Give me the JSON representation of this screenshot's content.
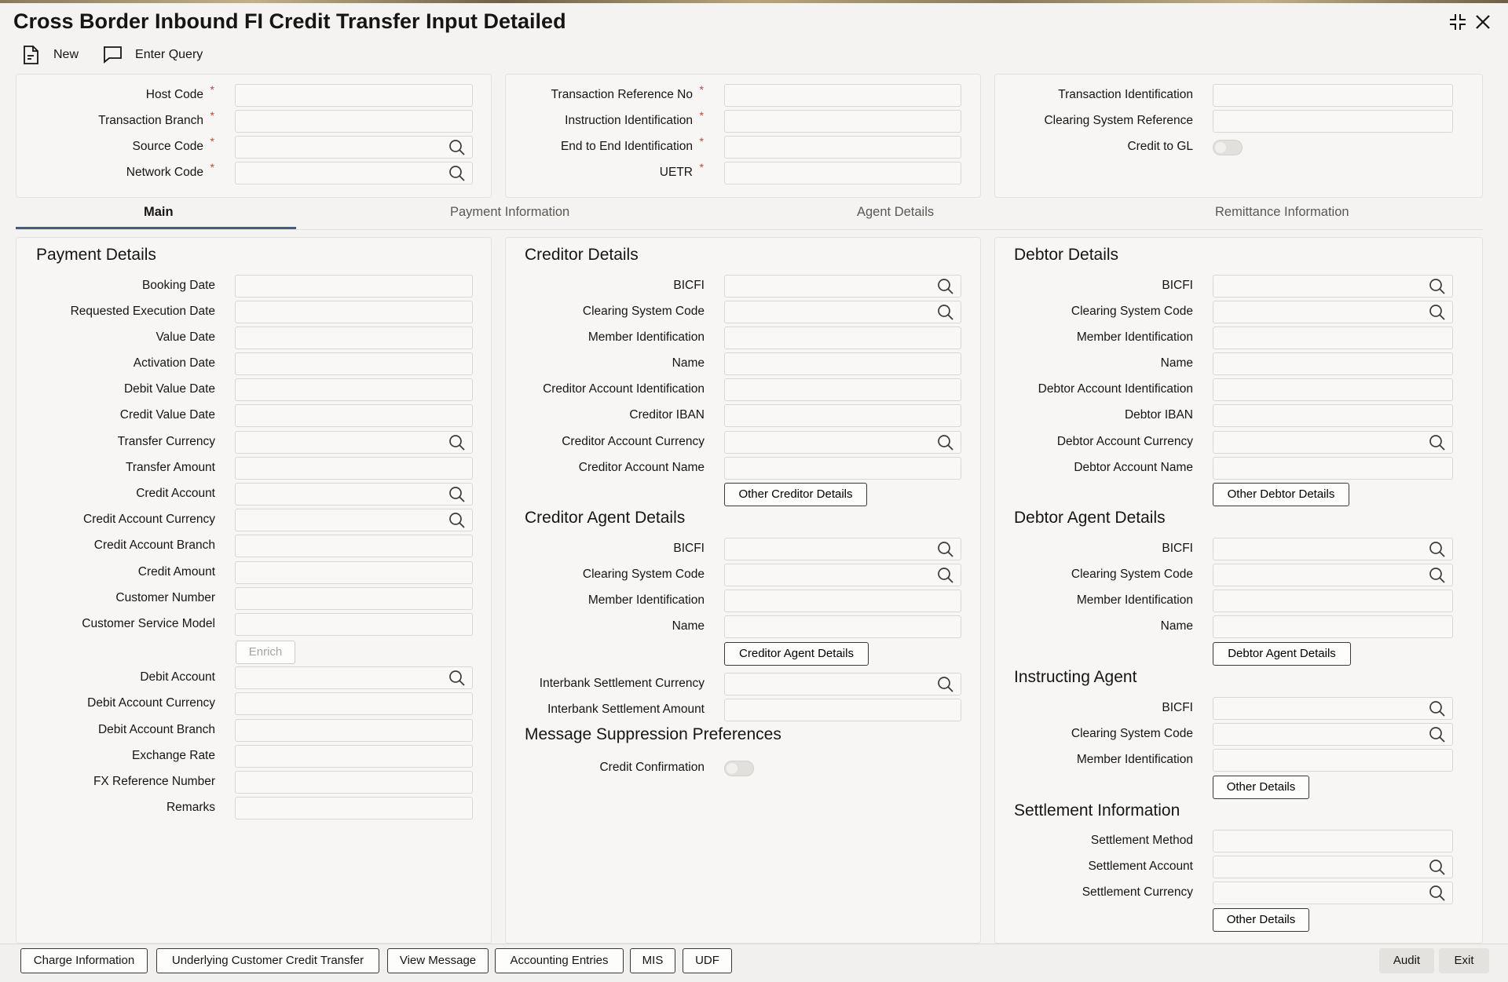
{
  "window": {
    "title": "Cross Border Inbound FI Credit Transfer Input Detailed"
  },
  "toolbar": {
    "new_label": "New",
    "enter_query_label": "Enter Query"
  },
  "header": {
    "col1": [
      {
        "label": "Host Code",
        "required": "*"
      },
      {
        "label": "Transaction Branch",
        "required": "*"
      },
      {
        "label": "Source Code",
        "required": "*"
      },
      {
        "label": "Network Code",
        "required": "*"
      }
    ],
    "col2": [
      {
        "label": "Transaction Reference No",
        "required": "*"
      },
      {
        "label": "Instruction Identification",
        "required": "*"
      },
      {
        "label": "End to End Identification",
        "required": "*"
      },
      {
        "label": "UETR",
        "required": "*"
      }
    ],
    "col3": [
      {
        "label": "Transaction Identification"
      },
      {
        "label": "Clearing System Reference"
      },
      {
        "label": "Credit to GL"
      }
    ]
  },
  "tabs": [
    "Main",
    "Payment Information",
    "Agent Details",
    "Remittance Information"
  ],
  "payment_details": {
    "title": "Payment Details",
    "fields": [
      "Booking Date",
      "Requested Execution Date",
      "Value Date",
      "Activation Date",
      "Debit Value Date",
      "Credit Value Date",
      "Transfer Currency",
      "Transfer Amount",
      "Credit Account",
      "Credit Account Currency",
      "Credit Account Branch",
      "Credit Amount",
      "Customer Number",
      "Customer Service Model"
    ],
    "enrich_label": "Enrich",
    "fields2": [
      "Debit Account",
      "Debit Account Currency",
      "Debit Account Branch",
      "Exchange Rate",
      "FX Reference Number",
      "Remarks"
    ]
  },
  "creditor_details": {
    "title": "Creditor Details",
    "fields": [
      "BICFI",
      "Clearing System Code",
      "Member Identification",
      "Name",
      "Creditor Account Identification",
      "Creditor IBAN",
      "Creditor Account Currency",
      "Creditor Account Name"
    ],
    "button": "Other Creditor Details"
  },
  "creditor_agent": {
    "title": "Creditor Agent Details",
    "fields": [
      "BICFI",
      "Clearing System Code",
      "Member Identification",
      "Name"
    ],
    "button": "Creditor Agent Details",
    "fields2": [
      "Interbank Settlement Currency",
      "Interbank Settlement Amount"
    ]
  },
  "message_suppression": {
    "title": "Message Suppression Preferences",
    "credit_confirmation": "Credit Confirmation"
  },
  "debtor_details": {
    "title": "Debtor Details",
    "fields": [
      "BICFI",
      "Clearing System Code",
      "Member Identification",
      "Name",
      "Debtor Account Identification",
      "Debtor IBAN",
      "Debtor Account Currency",
      "Debtor Account Name"
    ],
    "button": "Other Debtor Details"
  },
  "debtor_agent": {
    "title": "Debtor Agent Details",
    "fields": [
      "BICFI",
      "Clearing System Code",
      "Member Identification",
      "Name"
    ],
    "button": "Debtor Agent Details"
  },
  "instructing_agent": {
    "title": "Instructing Agent",
    "fields": [
      "BICFI",
      "Clearing System Code",
      "Member Identification"
    ],
    "button": "Other Details"
  },
  "settlement": {
    "title": "Settlement Information",
    "fields": [
      "Settlement Method",
      "Settlement Account",
      "Settlement Currency"
    ],
    "button": "Other Details"
  },
  "footer": {
    "buttons": [
      "Charge Information",
      "Underlying Customer Credit Transfer",
      "View Message",
      "Accounting Entries",
      "MIS",
      "UDF"
    ],
    "audit": "Audit",
    "exit": "Exit"
  }
}
